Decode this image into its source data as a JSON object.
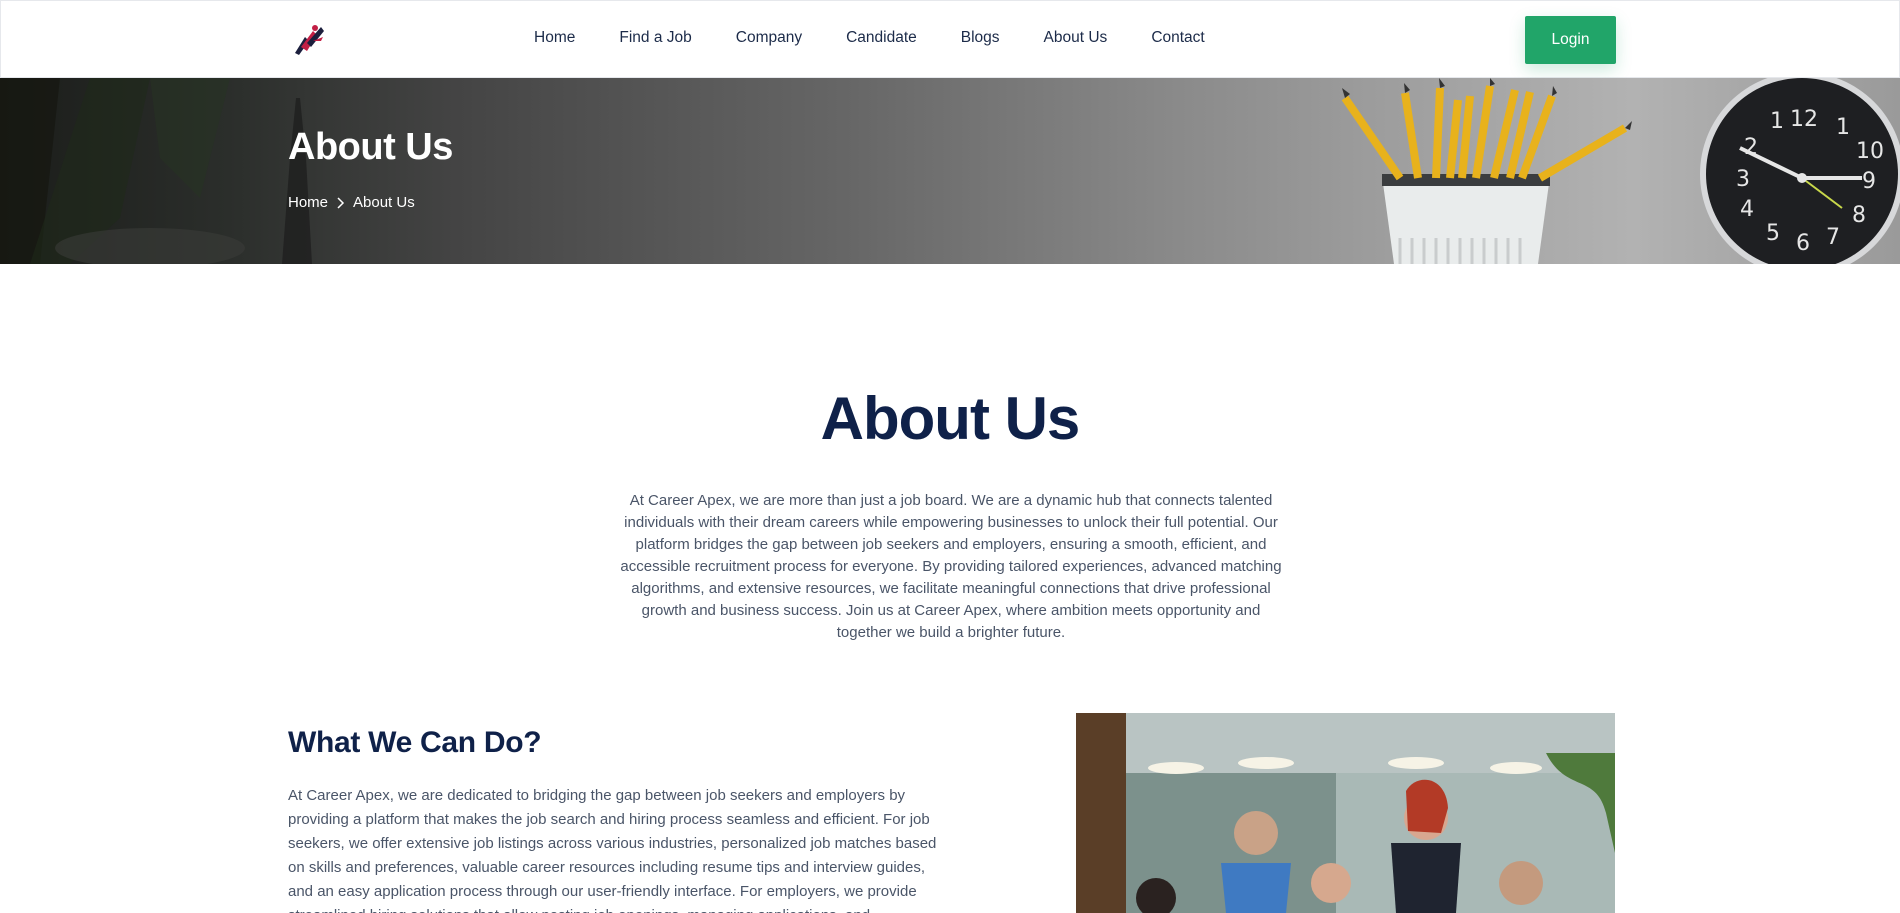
{
  "header": {
    "logo_icon": "career-apex-logo-icon",
    "nav": [
      "Home",
      "Find a Job",
      "Company",
      "Candidate",
      "Blogs",
      "About Us",
      "Contact"
    ],
    "login_label": "Login"
  },
  "banner": {
    "title": "About Us",
    "breadcrumb": {
      "home": "Home",
      "current": "About Us",
      "separator_icon": "chevron-right-icon"
    }
  },
  "about": {
    "title": "About Us",
    "text": "At Career Apex, we are more than just a job board. We are a dynamic hub that connects talented individuals with their dream careers while empowering businesses to unlock their full potential. Our platform bridges the gap between job seekers and employers, ensuring a smooth, efficient, and accessible recruitment process for everyone. By providing tailored experiences, advanced matching algorithms, and extensive resources, we facilitate meaningful connections that drive professional growth and business success. Join us at Career Apex, where ambition meets opportunity and together we build a brighter future."
  },
  "what_we_do": {
    "title": "What We Can Do?",
    "text": "At Career Apex, we are dedicated to bridging the gap between job seekers and employers by providing a platform that makes the job search and hiring process seamless and efficient. For job seekers, we offer extensive job listings across various industries, personalized job matches based on skills and preferences, valuable career resources including resume tips and interview guides, and an easy application process through our user-friendly interface. For employers, we provide streamlined hiring solutions that allow posting job openings, managing applications, and organizing"
  },
  "colors": {
    "brand_green": "#21a569",
    "heading_navy": "#0f2149",
    "body_text": "#4a5568"
  }
}
